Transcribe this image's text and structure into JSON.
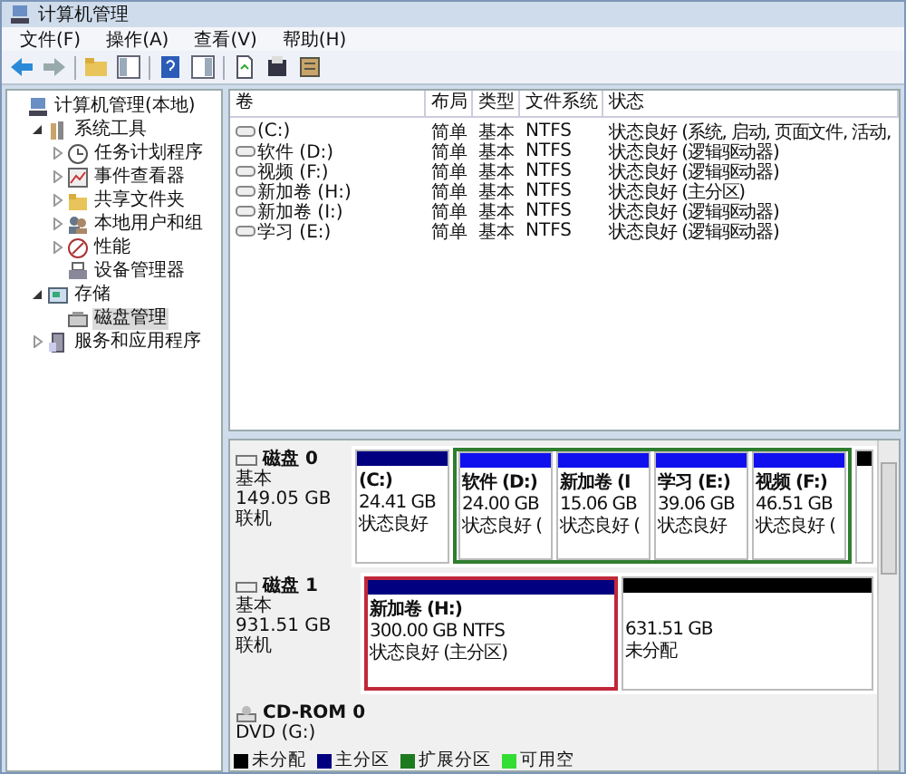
{
  "window": {
    "title": "计算机管理"
  },
  "menu": [
    "文件(F)",
    "操作(A)",
    "查看(V)",
    "帮助(H)"
  ],
  "toolbar": [
    {
      "kind": "back"
    },
    {
      "kind": "forward"
    },
    {
      "kind": "up"
    },
    {
      "kind": "tree"
    },
    {
      "kind": "help"
    },
    {
      "kind": "pane"
    },
    {
      "kind": "export"
    },
    {
      "kind": "properties"
    },
    {
      "kind": "wizard"
    }
  ],
  "tree": [
    {
      "label": "计算机管理(本地)",
      "selected": false,
      "children": [
        {
          "label": "系统工具",
          "expanded": true,
          "selected": false,
          "children": [
            {
              "label": "任务计划程序",
              "expanded": false,
              "selected": false
            },
            {
              "label": "事件查看器",
              "expanded": false,
              "selected": false
            },
            {
              "label": "共享文件夹",
              "expanded": false,
              "selected": false
            },
            {
              "label": "本地用户和组",
              "expanded": false,
              "selected": false
            },
            {
              "label": "性能",
              "expanded": false,
              "selected": false
            },
            {
              "label": "设备管理器",
              "selected": false
            }
          ]
        },
        {
          "label": "存储",
          "expanded": true,
          "selected": false,
          "children": [
            {
              "label": "磁盘管理",
              "selected": true
            }
          ]
        },
        {
          "label": "服务和应用程序",
          "expanded": false,
          "selected": false
        }
      ]
    }
  ],
  "volumes": {
    "columns": [
      "卷",
      "布局",
      "类型",
      "文件系统",
      "状态"
    ],
    "rows": [
      {
        "cells": [
          "(C:)",
          "简单",
          "基本",
          "NTFS",
          "状态良好 (系统, 启动, 页面文件, 活动,"
        ]
      },
      {
        "cells": [
          "软件 (D:)",
          "简单",
          "基本",
          "NTFS",
          "状态良好 (逻辑驱动器)"
        ]
      },
      {
        "cells": [
          "视频 (F:)",
          "简单",
          "基本",
          "NTFS",
          "状态良好 (逻辑驱动器)"
        ]
      },
      {
        "cells": [
          "新加卷 (H:)",
          "简单",
          "基本",
          "NTFS",
          "状态良好 (主分区)"
        ]
      },
      {
        "cells": [
          "新加卷 (I:)",
          "简单",
          "基本",
          "NTFS",
          "状态良好 (逻辑驱动器)"
        ]
      },
      {
        "cells": [
          "学习 (E:)",
          "简单",
          "基本",
          "NTFS",
          "状态良好 (逻辑驱动器)"
        ]
      }
    ]
  },
  "disks": [
    {
      "kind": "disk",
      "name": "磁盘 0",
      "type": "基本",
      "size": "149.05 GB",
      "state": "联机",
      "segments": [
        {
          "kind": "primary",
          "title": "(C:)",
          "size": "24.41 GB",
          "status": "状态良好",
          "highlighted": false
        },
        {
          "kind": "extended",
          "segments": [
            {
              "kind": "logical",
              "title": "软件 (D:)",
              "size": "24.00 GB",
              "status": "状态良好 ("
            },
            {
              "kind": "logical",
              "title": "新加卷 (I",
              "size": "15.06 GB",
              "status": "状态良好 ("
            },
            {
              "kind": "logical",
              "title": "学习 (E:)",
              "size": "39.06 GB",
              "status": "状态良好"
            },
            {
              "kind": "logical",
              "title": "视频 (F:)",
              "size": "46.51 GB",
              "status": "状态良好 ("
            }
          ]
        },
        {
          "kind": "narrow"
        }
      ]
    },
    {
      "kind": "disk",
      "name": "磁盘 1",
      "type": "基本",
      "size": "931.51 GB",
      "state": "联机",
      "segments": [
        {
          "kind": "primary",
          "title": "新加卷 (H:)",
          "size": "300.00 GB NTFS",
          "status": "状态良好 (主分区)",
          "highlighted": true
        },
        {
          "kind": "unallocated",
          "size": "631.51 GB",
          "status": "未分配",
          "highlighted": false
        }
      ]
    },
    {
      "kind": "cdrom",
      "name": "CD-ROM 0",
      "type": "DVD (G:)"
    }
  ],
  "legend": [
    {
      "label": "未分配",
      "color": "#000000"
    },
    {
      "label": "主分区",
      "color": "#000080"
    },
    {
      "label": "扩展分区",
      "color": "#1e7a1e"
    },
    {
      "label": "可用空",
      "color": "#33dd33"
    }
  ]
}
